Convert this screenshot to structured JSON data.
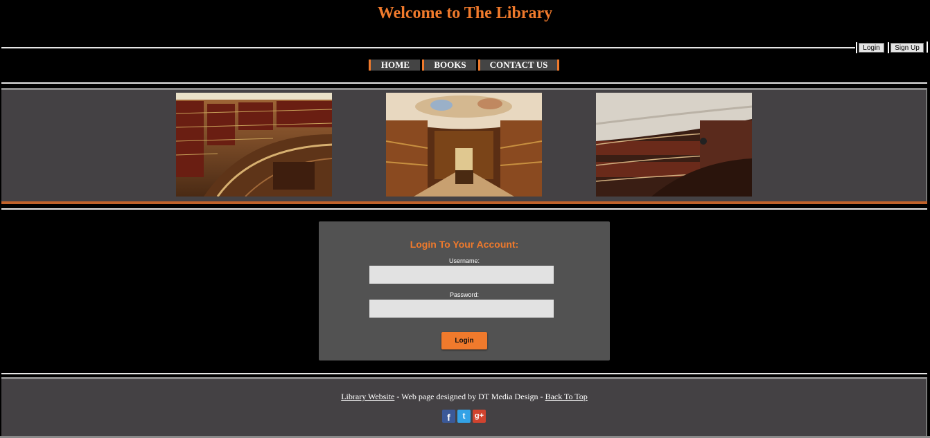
{
  "header": {
    "title": "Welcome to The Library"
  },
  "account": {
    "login_label": "Login",
    "signup_label": "Sign Up"
  },
  "nav": {
    "items": [
      "HOME",
      "BOOKS",
      "CONTACT US"
    ]
  },
  "gallery": {
    "images": [
      "library-photo-1",
      "library-photo-2",
      "library-photo-3"
    ]
  },
  "login_form": {
    "title": "Login To Your Account:",
    "username_label": "Username:",
    "username_value": "",
    "password_label": "Password:",
    "password_value": "",
    "submit_label": "Login"
  },
  "footer": {
    "site_link": "Library Website",
    "credit_text": " - Web page designed by DT Media Design - ",
    "back_to_top": "Back To Top",
    "social": [
      {
        "icon": "facebook-icon",
        "glyph": "f"
      },
      {
        "icon": "twitter-icon",
        "glyph": "t"
      },
      {
        "icon": "google-plus-icon",
        "glyph": "g+"
      }
    ]
  },
  "colors": {
    "accent": "#f07a2c",
    "panel": "#525252",
    "band": "#444144",
    "background": "#000000"
  }
}
